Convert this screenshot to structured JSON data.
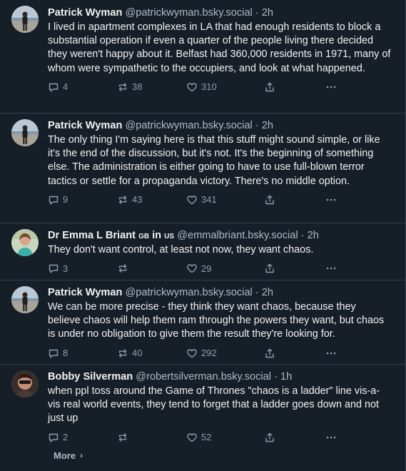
{
  "posts": [
    {
      "author": "Patrick Wyman",
      "flags": "",
      "handle": "@patrickwyman.bsky.social",
      "time": "2h",
      "text": "I lived in apartment complexes in LA that had enough residents to block a substantial operation if even a quarter of the people living there decided they weren't happy about it. Belfast had 360,000 residents in 1971, many of whom were sympathetic to the occupiers, and look at what happened.",
      "replies": "4",
      "reposts": "38",
      "likes": "310",
      "avatar": "beach-person"
    },
    {
      "author": "Patrick Wyman",
      "flags": "",
      "handle": "@patrickwyman.bsky.social",
      "time": "2h",
      "text": "The only thing I'm saying here is that this stuff might sound simple, or like it's the end of the discussion, but it's not. It's the beginning of something else. The administration is either going to have to use full-blown terror tactics or settle for a propaganda victory. There's no middle option.",
      "replies": "9",
      "reposts": "43",
      "likes": "341",
      "avatar": "beach-person"
    },
    {
      "author": "Dr Emma L Briant",
      "flags_gb": "GB",
      "flags_in": "in",
      "flags_us": "US",
      "handle": "@emmalbriant.bsky.social",
      "time": "2h",
      "text": "They don't want control, at least not now, they want chaos.",
      "replies": "3",
      "reposts": "",
      "likes": "29",
      "avatar": "woman-green"
    },
    {
      "author": "Patrick Wyman",
      "flags": "",
      "handle": "@patrickwyman.bsky.social",
      "time": "2h",
      "text": "We can be more precise - they think they want chaos, because they believe chaos will help them ram through the powers they want, but chaos is under no obligation to give them the result they're looking for.",
      "replies": "8",
      "reposts": "40",
      "likes": "292",
      "avatar": "beach-person"
    },
    {
      "author": "Bobby Silverman",
      "flags": "",
      "handle": "@robertsilverman.bsky.social",
      "time": "1h",
      "text": "when ppl toss around the Game of Thrones \"chaos is a ladder\" line vis-a-vis real world events, they tend to forget that a ladder goes down and not just up",
      "replies": "2",
      "reposts": "",
      "likes": "52",
      "avatar": "man-dark"
    }
  ],
  "separator": "·",
  "more_label": "More",
  "more_chevron": "›",
  "icons": [
    "reply-icon",
    "repost-icon",
    "like-icon",
    "share-icon",
    "more-icon"
  ],
  "colors": {
    "background": "#161e27",
    "text": "#f1f3f5",
    "muted": "#aebbc9",
    "border": "#2e4052"
  }
}
